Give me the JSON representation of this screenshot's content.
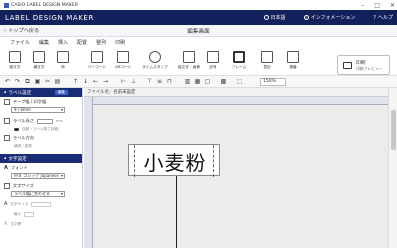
{
  "window": {
    "title": "CASIO LABEL DESIGN MAKER",
    "controls": [
      "–",
      "□",
      "✕"
    ]
  },
  "header": {
    "brand": "LABEL DESIGN MAKER",
    "language": "日本語",
    "info": "インフォメーション",
    "help": "ヘルプ"
  },
  "nav": {
    "back": "トップへ戻る",
    "mode_title": "編集画面"
  },
  "menu": [
    "ファイル",
    "編集",
    "挿入",
    "配置",
    "整列",
    "印刷"
  ],
  "ribbon": [
    {
      "label": "縦文字",
      "icon": "vertical-text-icon"
    },
    {
      "label": "横文字",
      "icon": "horizontal-text-icon"
    },
    {
      "label": "枠",
      "icon": "frame-icon"
    },
    {
      "label": "バーコード",
      "icon": "barcode-icon"
    },
    {
      "label": "QRコード",
      "icon": "qrcode-icon"
    },
    {
      "label": "タイムスタンプ",
      "icon": "timestamp-icon"
    },
    {
      "label": "絵文字・画像",
      "icon": "image-icon"
    },
    {
      "label": "記号",
      "icon": "symbol-icon"
    },
    {
      "label": "フレーム",
      "icon": "frame-template-icon"
    },
    {
      "label": "表記",
      "icon": "notation-icon"
    },
    {
      "label": "連番",
      "icon": "serial-number-icon"
    }
  ],
  "print": {
    "label": "印刷",
    "sublabel": "印刷プレビュー"
  },
  "toolbar": {
    "zoom": "150%"
  },
  "sidebar": {
    "label_section": "ラベル設定",
    "edit_label": "編集",
    "tape_width_label": "テープ幅 / 印字幅",
    "tape_width_value": "9 / 8mm",
    "label_length_label": "ラベル長さ",
    "label_length_unit": "mm",
    "auto_label": "自動（ラベル長さ自動）",
    "direction_label": "ラベル方向",
    "direction_value": "横書 / 縦書",
    "text_section": "文字設定",
    "font_label": "フォント",
    "font_value": "ＭＳ ゴシック Japanese",
    "char_size_label": "文字サイズ",
    "char_size_value": "ラベル幅に合わせる",
    "small_text_label": "文字サイズ",
    "small_text_value": "最小",
    "char_spacing_label": "文字間"
  },
  "canvas": {
    "file_tab": "ファイル名：名前未設定",
    "label_text": "小麦粉"
  }
}
